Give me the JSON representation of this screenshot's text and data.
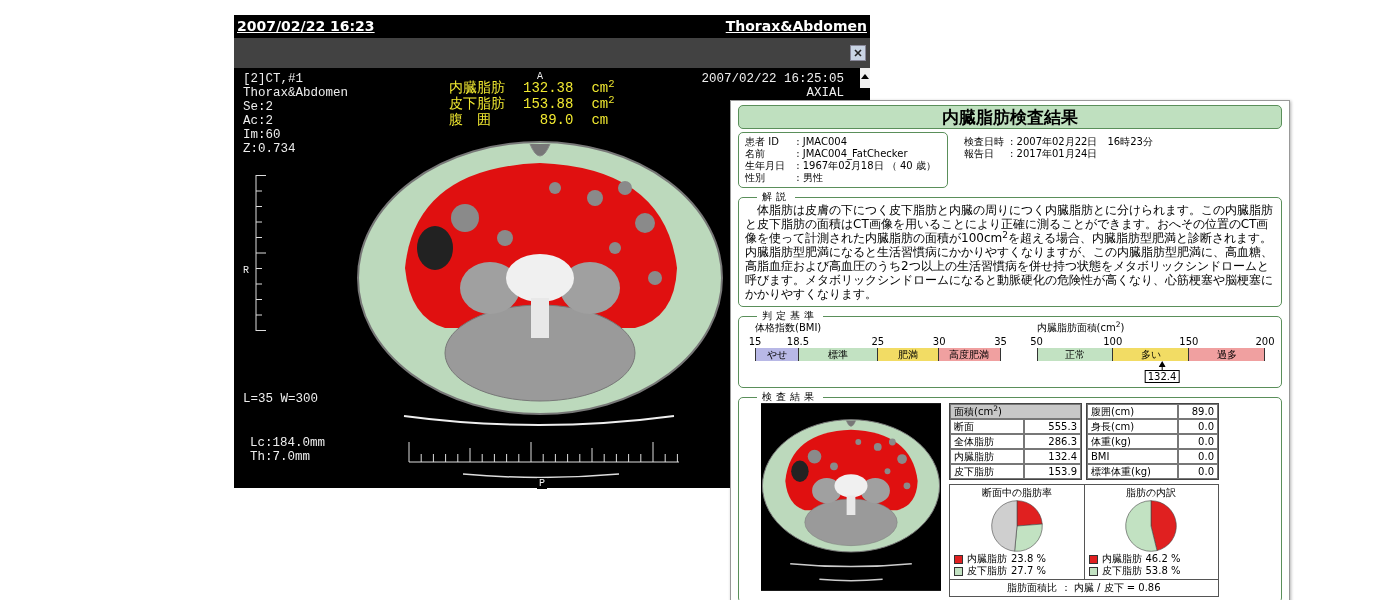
{
  "viewer": {
    "title_date": "2007/02/22 16:23",
    "title_series": "Thorax&Abdomen",
    "overlay": {
      "info_lines": [
        "[2]CT,#1",
        "Thorax&Abdomen",
        "Se:2",
        "Ac:2",
        "Im:60",
        "Z:0.734"
      ],
      "orientation_top": "A",
      "datetime": "2007/02/22 16:25:05",
      "plane": "AXIAL",
      "measurements": [
        {
          "label": "内臓脂肪",
          "value": "132.38",
          "unit": "cm$^{2}$"
        },
        {
          "label": "皮下脂肪",
          "value": "153.88",
          "unit": "cm$^{2}$"
        },
        {
          "label": "腹　囲",
          "value": "89.0",
          "unit": "cm"
        }
      ],
      "orientation_left": "R",
      "window_level": "L=35 W=300",
      "geometry_lines": [
        "Lc:184.0mm",
        "Th:7.0mm"
      ],
      "orientation_bottom": "P"
    }
  },
  "report": {
    "title": "内臓脂肪検査結果",
    "patient": [
      {
        "label": "患者 ID",
        "value": ": JMAC004"
      },
      {
        "label": "名前",
        "value": ": JMAC004_FatChecker"
      },
      {
        "label": "生年月日",
        "value": ": 1967年02月18日 （ 40 歳）"
      },
      {
        "label": "性別",
        "value": ": 男性"
      }
    ],
    "dates": [
      {
        "label": "検査日時",
        "value": ": 2007年02月22日　16時23分"
      },
      {
        "label": "報告日",
        "value": ": 2017年01月24日"
      }
    ],
    "explanation": {
      "heading": "解説",
      "text": "体脂肪は皮膚の下につく皮下脂肪と内臓の周りにつく内臓脂肪とに分けられます。この内臓脂肪と皮下脂肪の面積はCT画像を用いることにより正確に測ることができます。おへその位置のCT画像を使って計測された内臓脂肪の面積が100cm$^{2}$を超える場合、内臓脂肪型肥満と診断されます。内臓脂肪型肥満になると生活習慣病にかかりやすくなりますが、この内臓脂肪型肥満に、高血糖、高脂血症および高血圧のうち2つ以上の生活習慣病を併せ持つ状態をメタボリックシンドロームと呼びます。メタボリックシンドロームになると動脈硬化の危険性が高くなり、心筋梗塞や脳梗塞にかかりやすくなります。"
    },
    "criteria": {
      "heading": "判定基準",
      "scales": [
        {
          "title": "体格指数(BMI)",
          "ticks": [
            "15",
            "18.5",
            "25",
            "30",
            "35"
          ],
          "segments": [
            {
              "label": "やせ",
              "color": "#b8b8e6"
            },
            {
              "label": "標準",
              "color": "#c2e2c2"
            },
            {
              "label": "肥満",
              "color": "#f2dc64"
            },
            {
              "label": "高度肥満",
              "color": "#f0a0a0"
            }
          ]
        },
        {
          "title": "内臓脂肪面積(cm$^{2}$)",
          "ticks": [
            "50",
            "100",
            "150",
            "200"
          ],
          "segments": [
            {
              "label": "正常",
              "color": "#c2e2c2"
            },
            {
              "label": "多い",
              "color": "#f2dc64"
            },
            {
              "label": "過多",
              "color": "#f0a0a0"
            }
          ],
          "marker": {
            "level": 0.549,
            "reading": "132.4"
          }
        }
      ]
    },
    "results": {
      "heading": "検査結果",
      "area_table": {
        "header": "面積(cm$^{2}$)",
        "rows": [
          {
            "label": "断面",
            "value": "555.3"
          },
          {
            "label": "全体脂肪",
            "value": "286.3"
          },
          {
            "label": "内臓脂肪",
            "value": "132.4"
          },
          {
            "label": "皮下脂肪",
            "value": "153.9"
          }
        ]
      },
      "body_table": {
        "rows": [
          {
            "label": "腹囲(cm)",
            "value": "89.0"
          },
          {
            "label": "身長(cm)",
            "value": "0.0"
          },
          {
            "label": "体重(kg)",
            "value": "0.0"
          },
          {
            "label": "BMI",
            "value": "0.0"
          },
          {
            "label": "標準体重(kg)",
            "value": "0.0"
          }
        ]
      },
      "pies": [
        {
          "chart_data": {
            "type": "pie",
            "title": "断面中の脂肪率",
            "categories": [
              "内臓脂肪",
              "皮下脂肪",
              null
            ],
            "values": [
              23.8,
              27.7,
              48.5
            ]
          },
          "legend": [
            {
              "value": "23.8 %",
              "color": "#e02020"
            },
            {
              "value": "27.7 %",
              "color": "#c2e2c2"
            }
          ]
        },
        {
          "chart_data": {
            "type": "pie",
            "title": "脂肪の内訳",
            "categories": [
              "内臓脂肪",
              "皮下脂肪"
            ],
            "values": [
              46.2,
              53.8
            ]
          },
          "legend": [
            {
              "value": "46.2 %",
              "color": "#e02020"
            },
            {
              "value": "53.8 %",
              "color": "#c2e2c2"
            }
          ]
        }
      ],
      "ratio": "脂肪面積比 ： 内臓 / 皮下 = 0.86"
    }
  }
}
